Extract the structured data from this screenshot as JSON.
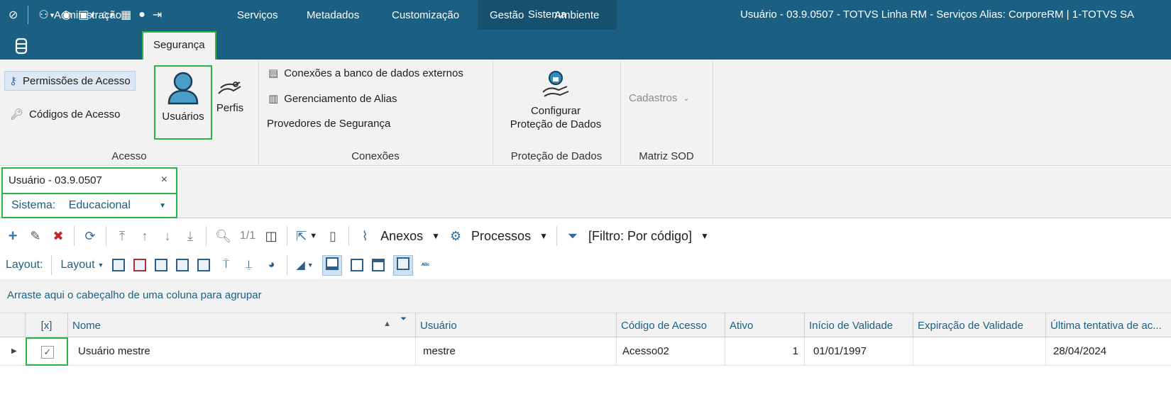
{
  "titlebar": {
    "context_label": "Sistema",
    "window_title": "Usuário - 03.9.0507 - TOTVS Linha RM - Serviços  Alias: CorporeRM | 1-TOTVS SA"
  },
  "ribbon_tabs": [
    "Administração",
    "Segurança",
    "Serviços",
    "Metadados",
    "Customização",
    "Gestão",
    "Ambiente"
  ],
  "ribbon": {
    "acesso": {
      "permissoes": "Permissões de Acesso",
      "codigos": "Códigos de Acesso",
      "usuarios": "Usuários",
      "perfis": "Perfis",
      "label": "Acesso"
    },
    "conexoes": {
      "banco": "Conexões a banco de dados externos",
      "alias": "Gerenciamento de Alias",
      "provedores": "Provedores de Segurança",
      "label": "Conexões"
    },
    "protecao": {
      "configurar_line1": "Configurar",
      "configurar_line2": "Proteção de Dados",
      "label": "Proteção de Dados"
    },
    "matriz": {
      "cadastros": "Cadastros",
      "label": "Matriz SOD"
    }
  },
  "document_tab": {
    "title": "Usuário - 03.9.0507",
    "close": "×"
  },
  "sistema": {
    "label": "Sistema:",
    "value": "Educacional"
  },
  "toolbar": {
    "pager": "1/1",
    "anexos": "Anexos",
    "processos": "Processos",
    "filtro": "[Filtro: Por código]",
    "layout_label": "Layout:",
    "layout_menu": "Layout"
  },
  "group_hint": "Arraste aqui o cabeçalho de uma coluna para agrupar",
  "grid": {
    "columns": [
      "[x]",
      "Nome",
      "Usuário",
      "Código de Acesso",
      "Ativo",
      "Início de Validade",
      "Expiração de Validade",
      "Última tentativa de ac..."
    ],
    "rows": [
      {
        "checked": "✓",
        "nome": "Usuário mestre",
        "usuario": "mestre",
        "codigo": "Acesso02",
        "ativo": "1",
        "inicio": "01/01/1997",
        "expiracao": "",
        "ultima": "28/04/2024"
      }
    ]
  }
}
